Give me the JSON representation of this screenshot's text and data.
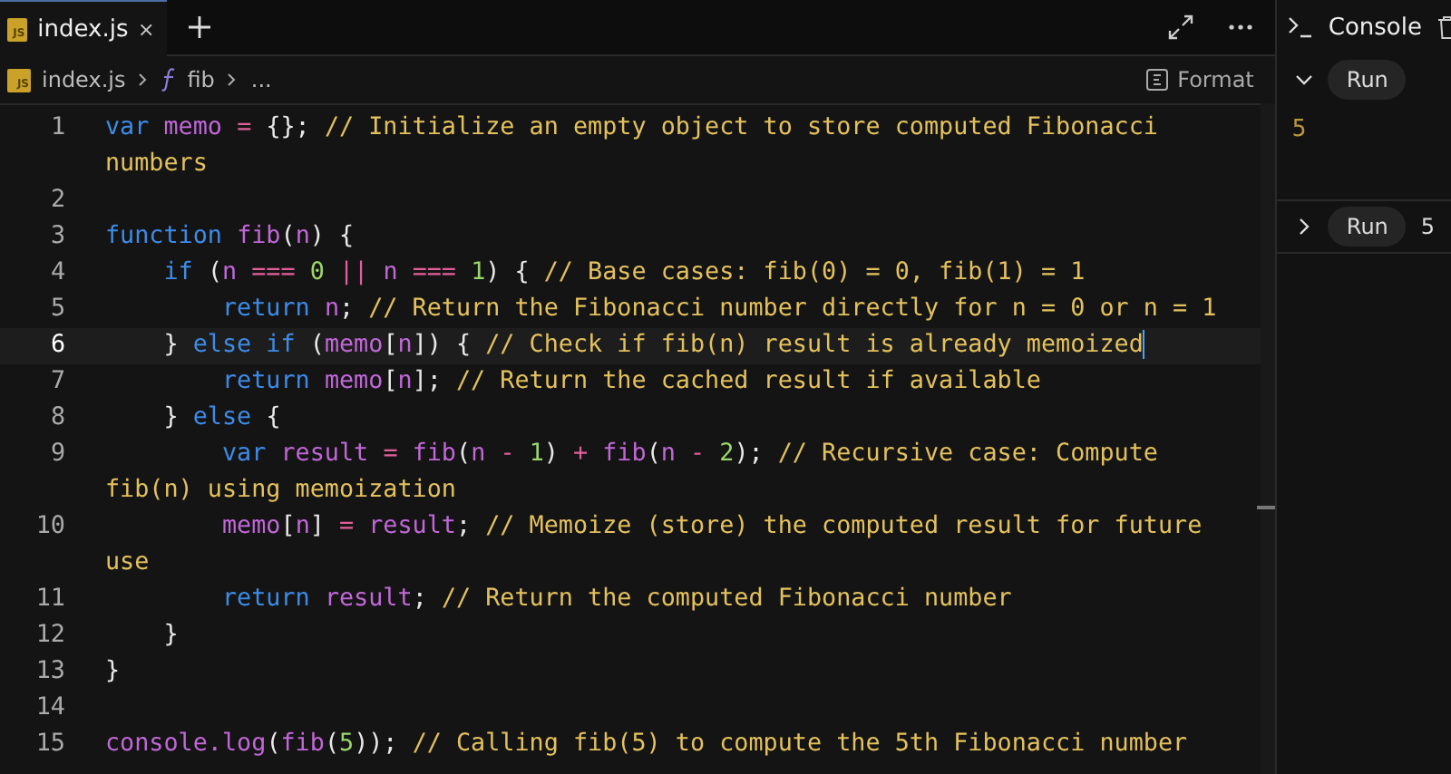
{
  "tabs": [
    {
      "label": "index.js",
      "badge": "JS",
      "selected": true
    }
  ],
  "breadcrumb": {
    "file": "index.js",
    "badge": "JS",
    "symbol": "fib",
    "more": "..."
  },
  "format_button": "Format",
  "code_lines": [
    {
      "number": "1",
      "current": false,
      "tokens": [
        {
          "t": "var ",
          "kind": "keyword"
        },
        {
          "t": "memo ",
          "kind": "variable"
        },
        {
          "t": "= ",
          "kind": "operator"
        },
        {
          "t": "{}; ",
          "kind": "punct"
        },
        {
          "t": "// Initialize an empty object to store computed Fibonacci numbers",
          "kind": "comment"
        }
      ]
    },
    {
      "number": "2",
      "current": false
    },
    {
      "number": "3",
      "current": false,
      "tokens": [
        {
          "t": "function ",
          "kind": "keyword"
        },
        {
          "t": "fib",
          "kind": "variable"
        },
        {
          "t": "(",
          "kind": "punct"
        },
        {
          "t": "n",
          "kind": "variable"
        },
        {
          "t": ") {",
          "kind": "punct"
        }
      ]
    },
    {
      "number": "4",
      "current": false,
      "tokens": [
        {
          "t": "    if ",
          "kind": "keyword"
        },
        {
          "t": "(",
          "kind": "punct"
        },
        {
          "t": "n ",
          "kind": "variable"
        },
        {
          "t": "=== ",
          "kind": "operator"
        },
        {
          "t": "0 ",
          "kind": "number"
        },
        {
          "t": "|| ",
          "kind": "operator"
        },
        {
          "t": "n ",
          "kind": "variable"
        },
        {
          "t": "=== ",
          "kind": "operator"
        },
        {
          "t": "1",
          "kind": "number"
        },
        {
          "t": ") { ",
          "kind": "punct"
        },
        {
          "t": "// Base cases: fib(0) = 0, fib(1) = 1",
          "kind": "comment"
        }
      ]
    },
    {
      "number": "5",
      "current": false,
      "tokens": [
        {
          "t": "        return ",
          "kind": "keyword"
        },
        {
          "t": "n",
          "kind": "variable"
        },
        {
          "t": "; ",
          "kind": "punct"
        },
        {
          "t": "// Return the Fibonacci number directly for n = 0 or n = 1",
          "kind": "comment"
        }
      ]
    },
    {
      "number": "6",
      "current": true,
      "tokens": [
        {
          "t": "    } ",
          "kind": "punct"
        },
        {
          "t": "else if ",
          "kind": "keyword"
        },
        {
          "t": "(",
          "kind": "punct"
        },
        {
          "t": "memo",
          "kind": "variable"
        },
        {
          "t": "[",
          "kind": "punct"
        },
        {
          "t": "n",
          "kind": "variable"
        },
        {
          "t": "]) { ",
          "kind": "punct"
        },
        {
          "t": "// Check if fib(n) result is already memoized",
          "kind": "comment"
        }
      ]
    },
    {
      "number": "7",
      "current": false,
      "tokens": [
        {
          "t": "        return ",
          "kind": "keyword"
        },
        {
          "t": "memo",
          "kind": "variable"
        },
        {
          "t": "[",
          "kind": "punct"
        },
        {
          "t": "n",
          "kind": "variable"
        },
        {
          "t": "]; ",
          "kind": "punct"
        },
        {
          "t": "// Return the cached result if available",
          "kind": "comment"
        }
      ]
    },
    {
      "number": "8",
      "current": false,
      "tokens": [
        {
          "t": "    } ",
          "kind": "punct"
        },
        {
          "t": "else ",
          "kind": "keyword"
        },
        {
          "t": "{",
          "kind": "punct"
        }
      ]
    },
    {
      "number": "9",
      "current": false,
      "tokens": [
        {
          "t": "        var ",
          "kind": "keyword"
        },
        {
          "t": "result ",
          "kind": "variable"
        },
        {
          "t": "= ",
          "kind": "operator"
        },
        {
          "t": "fib",
          "kind": "variable"
        },
        {
          "t": "(",
          "kind": "punct"
        },
        {
          "t": "n ",
          "kind": "variable"
        },
        {
          "t": "- ",
          "kind": "operator"
        },
        {
          "t": "1",
          "kind": "number"
        },
        {
          "t": ") ",
          "kind": "punct"
        },
        {
          "t": "+ ",
          "kind": "operator"
        },
        {
          "t": "fib",
          "kind": "variable"
        },
        {
          "t": "(",
          "kind": "punct"
        },
        {
          "t": "n ",
          "kind": "variable"
        },
        {
          "t": "- ",
          "kind": "operator"
        },
        {
          "t": "2",
          "kind": "number"
        },
        {
          "t": "); ",
          "kind": "punct"
        },
        {
          "t": "// Recursive case: Compute fib(n) using memoization",
          "kind": "comment"
        }
      ]
    },
    {
      "number": "10",
      "current": false,
      "tokens": [
        {
          "t": "        memo",
          "kind": "variable"
        },
        {
          "t": "[",
          "kind": "punct"
        },
        {
          "t": "n",
          "kind": "variable"
        },
        {
          "t": "] ",
          "kind": "punct"
        },
        {
          "t": "= ",
          "kind": "operator"
        },
        {
          "t": "result",
          "kind": "variable"
        },
        {
          "t": "; ",
          "kind": "punct"
        },
        {
          "t": "// Memoize (store) the computed result for future use",
          "kind": "comment"
        }
      ]
    },
    {
      "number": "11",
      "current": false,
      "tokens": [
        {
          "t": "        return ",
          "kind": "keyword"
        },
        {
          "t": "result",
          "kind": "variable"
        },
        {
          "t": "; ",
          "kind": "punct"
        },
        {
          "t": "// Return the computed Fibonacci number",
          "kind": "comment"
        }
      ]
    },
    {
      "number": "12",
      "current": false,
      "tokens": [
        {
          "t": "    }",
          "kind": "punct"
        }
      ]
    },
    {
      "number": "13",
      "current": false,
      "tokens": [
        {
          "t": "}",
          "kind": "punct"
        }
      ]
    },
    {
      "number": "14",
      "current": false
    },
    {
      "number": "15",
      "current": false,
      "tokens": [
        {
          "t": "console.log",
          "kind": "variable"
        },
        {
          "t": "(",
          "kind": "punct"
        },
        {
          "t": "fib",
          "kind": "variable"
        },
        {
          "t": "(",
          "kind": "punct"
        },
        {
          "t": "5",
          "kind": "number"
        },
        {
          "t": ")); ",
          "kind": "punct"
        },
        {
          "t": "// Calling fib(5) to compute the 5th Fibonacci number",
          "kind": "comment"
        }
      ]
    }
  ],
  "console": {
    "title": "Console",
    "runs": [
      {
        "label": "Run",
        "expanded": true,
        "output": "5"
      },
      {
        "label": "Run",
        "expanded": false,
        "output": "5"
      }
    ]
  }
}
